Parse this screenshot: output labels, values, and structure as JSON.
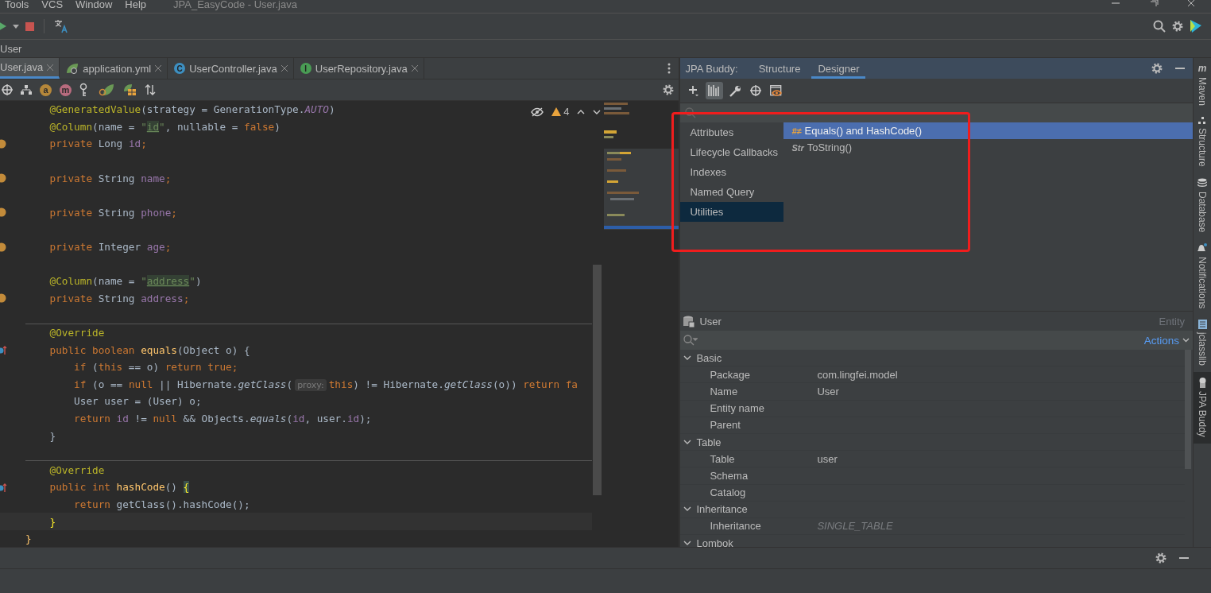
{
  "menu": [
    "Tools",
    "VCS",
    "Window",
    "Help"
  ],
  "window": {
    "title": "JPA_EasyCode - User.java"
  },
  "breadcrumb": "User",
  "editor_tabs": [
    {
      "label": "User.java",
      "selected": true,
      "kind": "file"
    },
    {
      "label": "application.yml",
      "selected": false,
      "kind": "spring"
    },
    {
      "label": "UserController.java",
      "selected": false,
      "kind": "class",
      "badge": "C"
    },
    {
      "label": "UserRepository.java",
      "selected": false,
      "kind": "interface",
      "badge": "I"
    }
  ],
  "editor_toolbar": [
    {
      "kind": "target"
    },
    {
      "kind": "hierarchy"
    },
    {
      "kind": "letter",
      "badge": "a",
      "color": "#b5873a"
    },
    {
      "kind": "letter",
      "badge": "m",
      "color": "#b86b7e"
    },
    {
      "kind": "key"
    },
    {
      "kind": "spring"
    },
    {
      "kind": "table"
    },
    {
      "kind": "sort"
    }
  ],
  "inspections": {
    "count": "4"
  },
  "code": [
    {
      "kind": "plain",
      "tokens": [
        {
          "t": "    @GeneratedValue",
          "kind": "ann"
        },
        {
          "t": "(strategy = GenerationType.",
          "kind": "pl"
        },
        {
          "t": "AUTO",
          "kind": "const"
        },
        {
          "t": ")",
          "kind": "pl"
        }
      ]
    },
    {
      "kind": "plain",
      "tokens": [
        {
          "t": "    @Column",
          "kind": "ann"
        },
        {
          "t": "(name = ",
          "kind": "pl"
        },
        {
          "t": "\"",
          "kind": "str"
        },
        {
          "t": "id",
          "kind": "strhl"
        },
        {
          "t": "\"",
          "kind": "str"
        },
        {
          "t": ", nullable = ",
          "kind": "pl"
        },
        {
          "t": "false",
          "kind": "kw"
        },
        {
          "t": ")",
          "kind": "pl"
        }
      ]
    },
    {
      "kind": "field",
      "tokens": [
        {
          "t": "    private ",
          "kind": "kw"
        },
        {
          "t": "Long ",
          "kind": "pl"
        },
        {
          "t": "id",
          "kind": "fld"
        },
        {
          "t": ";",
          "kind": "kw"
        }
      ]
    },
    {
      "kind": "blank"
    },
    {
      "kind": "field",
      "tokens": [
        {
          "t": "    private ",
          "kind": "kw"
        },
        {
          "t": "String ",
          "kind": "pl"
        },
        {
          "t": "name",
          "kind": "fld"
        },
        {
          "t": ";",
          "kind": "kw"
        }
      ]
    },
    {
      "kind": "blank"
    },
    {
      "kind": "field",
      "tokens": [
        {
          "t": "    private ",
          "kind": "kw"
        },
        {
          "t": "String ",
          "kind": "pl"
        },
        {
          "t": "phone",
          "kind": "fld"
        },
        {
          "t": ";",
          "kind": "kw"
        }
      ]
    },
    {
      "kind": "blank"
    },
    {
      "kind": "field",
      "tokens": [
        {
          "t": "    private ",
          "kind": "kw"
        },
        {
          "t": "Integer ",
          "kind": "pl"
        },
        {
          "t": "age",
          "kind": "fld"
        },
        {
          "t": ";",
          "kind": "kw"
        }
      ]
    },
    {
      "kind": "blank"
    },
    {
      "kind": "plain",
      "tokens": [
        {
          "t": "    @Column",
          "kind": "ann"
        },
        {
          "t": "(name = ",
          "kind": "pl"
        },
        {
          "t": "\"",
          "kind": "str"
        },
        {
          "t": "address",
          "kind": "strhl"
        },
        {
          "t": "\"",
          "kind": "str"
        },
        {
          "t": ")",
          "kind": "pl"
        }
      ]
    },
    {
      "kind": "field",
      "tokens": [
        {
          "t": "    private ",
          "kind": "kw"
        },
        {
          "t": "String ",
          "kind": "pl"
        },
        {
          "t": "address",
          "kind": "fld"
        },
        {
          "t": ";",
          "kind": "kw"
        }
      ]
    },
    {
      "kind": "separator"
    },
    {
      "kind": "plain",
      "tokens": [
        {
          "t": "    @Override",
          "kind": "ann"
        }
      ]
    },
    {
      "kind": "override",
      "tokens": [
        {
          "t": "    public boolean ",
          "kind": "kw"
        },
        {
          "t": "equals",
          "kind": "fn"
        },
        {
          "t": "(Object o) {",
          "kind": "pl"
        }
      ]
    },
    {
      "kind": "plain",
      "tokens": [
        {
          "t": "        if ",
          "kind": "kw"
        },
        {
          "t": "(",
          "kind": "pl"
        },
        {
          "t": "this",
          "kind": "kw"
        },
        {
          "t": " == o) ",
          "kind": "pl"
        },
        {
          "t": "return true;",
          "kind": "kw"
        }
      ]
    },
    {
      "kind": "plain",
      "tokens": [
        {
          "t": "        if ",
          "kind": "kw"
        },
        {
          "t": "(o == ",
          "kind": "pl"
        },
        {
          "t": "null",
          "kind": "kw"
        },
        {
          "t": " || Hibernate.",
          "kind": "pl"
        },
        {
          "t": "getClass",
          "kind": "mi"
        },
        {
          "t": "(",
          "kind": "pl"
        },
        {
          "t": "proxy:",
          "kind": "hint"
        },
        {
          "t": "this",
          "kind": "kw"
        },
        {
          "t": ") != Hibernate.",
          "kind": "pl"
        },
        {
          "t": "getClass",
          "kind": "mi"
        },
        {
          "t": "(o)) ",
          "kind": "pl"
        },
        {
          "t": "return fa",
          "kind": "kw"
        }
      ]
    },
    {
      "kind": "plain",
      "tokens": [
        {
          "t": "        User user = (User) o;",
          "kind": "pl"
        }
      ]
    },
    {
      "kind": "plain",
      "tokens": [
        {
          "t": "        return ",
          "kind": "kw"
        },
        {
          "t": "id",
          "kind": "fld"
        },
        {
          "t": " != ",
          "kind": "pl"
        },
        {
          "t": "null",
          "kind": "kw"
        },
        {
          "t": " && Objects.",
          "kind": "pl"
        },
        {
          "t": "equals",
          "kind": "mi"
        },
        {
          "t": "(",
          "kind": "pl"
        },
        {
          "t": "id",
          "kind": "fld"
        },
        {
          "t": ", user.",
          "kind": "pl"
        },
        {
          "t": "id",
          "kind": "fld"
        },
        {
          "t": ");",
          "kind": "pl"
        }
      ]
    },
    {
      "kind": "plain",
      "tokens": [
        {
          "t": "    }",
          "kind": "pl"
        }
      ]
    },
    {
      "kind": "separator"
    },
    {
      "kind": "plain",
      "tokens": [
        {
          "t": "    @Override",
          "kind": "ann"
        }
      ]
    },
    {
      "kind": "override",
      "tokens": [
        {
          "t": "    public int ",
          "kind": "kw"
        },
        {
          "t": "hashCode",
          "kind": "fn"
        },
        {
          "t": "() ",
          "kind": "pl"
        },
        {
          "t": "{",
          "kind": "match"
        }
      ]
    },
    {
      "kind": "plain",
      "tokens": [
        {
          "t": "        return ",
          "kind": "kw"
        },
        {
          "t": "getClass().hashCode();",
          "kind": "pl"
        }
      ]
    },
    {
      "kind": "current",
      "tokens": [
        {
          "t": "    }",
          "kind": "brace"
        }
      ]
    },
    {
      "kind": "plain",
      "tokens": [
        {
          "t": "}",
          "kind": "fn"
        }
      ]
    }
  ],
  "jpa_buddy": {
    "label": "JPA Buddy:",
    "tabs": [
      {
        "label": "Structure",
        "selected": false
      },
      {
        "label": "Designer",
        "selected": true
      }
    ],
    "toolbar": [
      {
        "kind": "add",
        "selected": false
      },
      {
        "kind": "columns",
        "selected": true
      },
      {
        "kind": "wrench",
        "selected": false
      },
      {
        "kind": "target",
        "selected": false
      },
      {
        "kind": "preview",
        "selected": false
      }
    ],
    "categories": [
      {
        "label": "Attributes",
        "selected": false
      },
      {
        "label": "Lifecycle Callbacks",
        "selected": false
      },
      {
        "label": "Indexes",
        "selected": false
      },
      {
        "label": "Named Query",
        "selected": false
      },
      {
        "label": "Utilities",
        "selected": true
      }
    ],
    "utilities": [
      {
        "label": "Equals() and HashCode()",
        "badge": "#≠",
        "selected": true
      },
      {
        "label": "ToString()",
        "badge": "Str",
        "selected": false
      }
    ]
  },
  "entity": {
    "name": "User",
    "kind": "Entity",
    "actions": "Actions",
    "groups": [
      {
        "label": "Basic",
        "expanded": true,
        "children": [
          {
            "label": "Package",
            "value": "com.lingfei.model",
            "default": false
          },
          {
            "label": "Name",
            "value": "User",
            "default": false
          },
          {
            "label": "Entity name"
          },
          {
            "label": "Parent"
          }
        ]
      },
      {
        "label": "Table",
        "expanded": true,
        "children": [
          {
            "label": "Table",
            "value": "user",
            "default": false
          },
          {
            "label": "Schema"
          },
          {
            "label": "Catalog"
          }
        ]
      },
      {
        "label": "Inheritance",
        "expanded": true,
        "children": [
          {
            "label": "Inheritance",
            "value": "SINGLE_TABLE",
            "default": true
          }
        ]
      },
      {
        "label": "Lombok",
        "expanded": true
      }
    ]
  },
  "side_stripe": [
    {
      "label": "Maven",
      "kind": "maven",
      "badge": "m",
      "selected": false
    },
    {
      "label": "Structure",
      "kind": "structure",
      "selected": false
    },
    {
      "label": "Database",
      "kind": "database",
      "selected": false
    },
    {
      "label": "Notifications",
      "kind": "bell",
      "selected": false
    },
    {
      "label": "jclasslib",
      "kind": "jclasslib",
      "selected": false
    },
    {
      "label": "JPA Buddy",
      "kind": "jpa",
      "selected": true
    }
  ]
}
